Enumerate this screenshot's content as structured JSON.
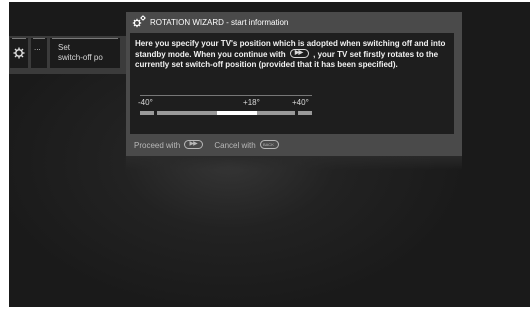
{
  "left_menu": {
    "dots_label": "...",
    "set_line1": "Set",
    "set_line2": "switch-off po"
  },
  "wizard": {
    "title": "ROTATION WIZARD - start information",
    "text_part1": "Here you specify your TV's position which is adopted when switching off and into standby mode.  When you continue with",
    "text_part2": ", your TV set firstly rotates to the currently set switch-off position (provided that it has been specified).",
    "scale": {
      "min_label": "-40°",
      "mid_label": "+18°",
      "max_label": "+40°",
      "min_value": -40,
      "max_value": 40,
      "current_value": 18
    },
    "proceed_label": "Proceed with",
    "cancel_label": "Cancel with",
    "back_key_label": "BACK"
  },
  "colors": {
    "bar_grey": "#9a9a9a",
    "bar_white": "#ffffff",
    "panel": "#4a4a4a",
    "panel_body": "#1e1e1e"
  }
}
